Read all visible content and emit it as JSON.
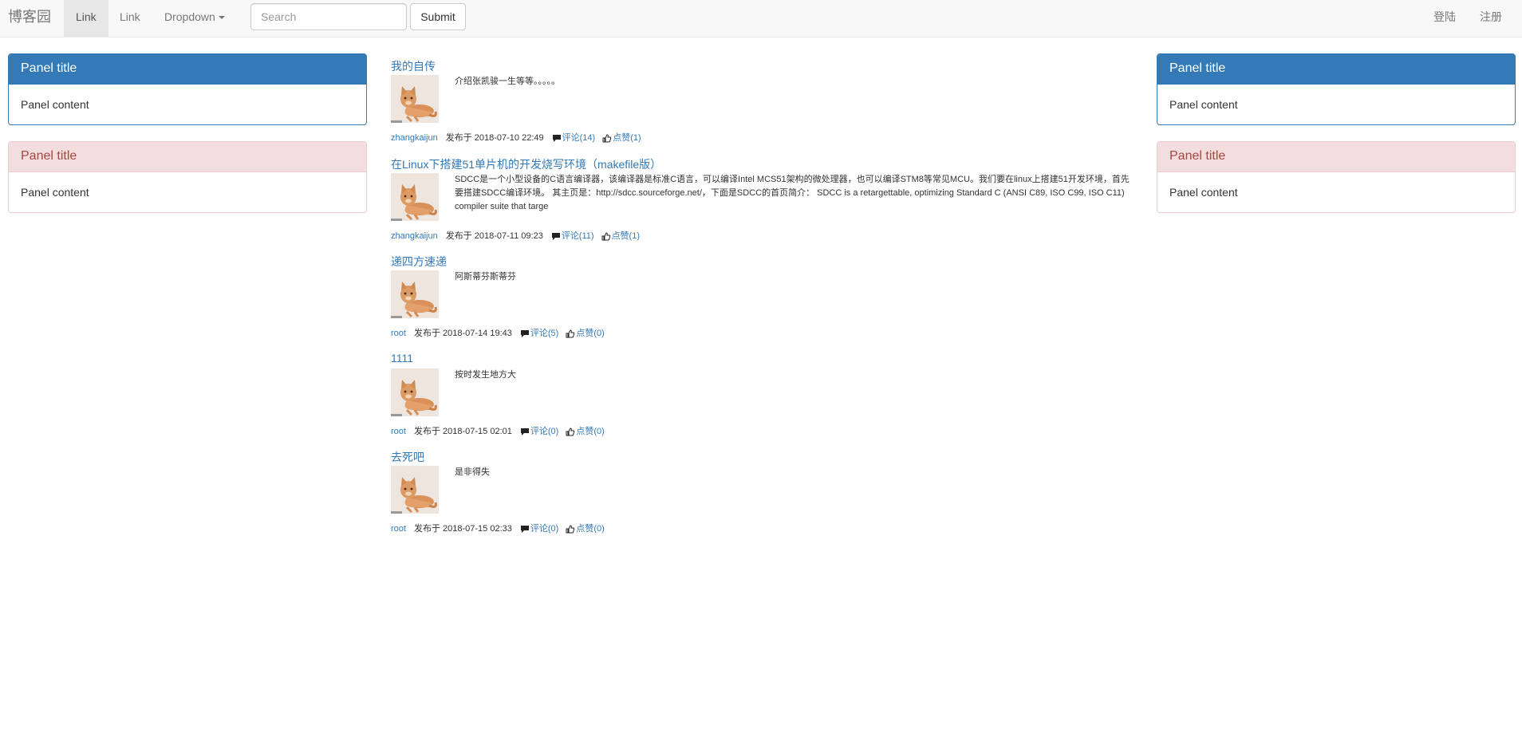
{
  "navbar": {
    "brand": "博客园",
    "links": [
      "Link",
      "Link"
    ],
    "dropdown_label": "Dropdown",
    "search_placeholder": "Search",
    "submit_label": "Submit",
    "login_label": "登陆",
    "register_label": "注册"
  },
  "left_panels": [
    {
      "title": "Panel title",
      "content": "Panel content",
      "style": "primary"
    },
    {
      "title": "Panel title",
      "content": "Panel content",
      "style": "danger"
    }
  ],
  "right_panels": [
    {
      "title": "Panel title",
      "content": "Panel content",
      "style": "primary"
    },
    {
      "title": "Panel title",
      "content": "Panel content",
      "style": "danger"
    }
  ],
  "articles": [
    {
      "title": "我的自传",
      "summary": "介绍张凯骏一生等等。。。。。",
      "author": "zhangkaijun",
      "date": "发布于 2018-07-10 22:49",
      "comments": "评论(14)",
      "likes": "点赞(1)"
    },
    {
      "title": "在Linux下搭建51单片机的开发烧写环境（makefile版）",
      "summary": "SDCC是一个小型设备的C语言编译器，该编译器是标准C语言，可以编译Intel MCS51架构的微处理器，也可以编译STM8等常见MCU。我们要在linux上搭建51开发环境，首先要搭建SDCC编译环境。 其主页是：http://sdcc.sourceforge.net/，下面是SDCC的首页简介： SDCC is a retargettable, optimizing Standard C (ANSI C89, ISO C99, ISO C11) compiler suite that targe",
      "author": "zhangkaijun",
      "date": "发布于 2018-07-11 09:23",
      "comments": "评论(11)",
      "likes": "点赞(1)"
    },
    {
      "title": "递四方速递",
      "summary": "阿斯蒂芬斯蒂芬",
      "author": "root",
      "date": "发布于 2018-07-14 19:43",
      "comments": "评论(5)",
      "likes": "点赞(0)"
    },
    {
      "title": "1111",
      "summary": "按时发生地方大",
      "author": "root",
      "date": "发布于 2018-07-15 02:01",
      "comments": "评论(0)",
      "likes": "点赞(0)"
    },
    {
      "title": "去死吧",
      "summary": "是非得失",
      "author": "root",
      "date": "发布于 2018-07-15 02:33",
      "comments": "评论(0)",
      "likes": "点赞(0)"
    }
  ],
  "icons": {
    "comment": "comment-icon",
    "like": "thumbs-up-icon",
    "thumbnail": "cat-photo-thumbnail"
  },
  "colors": {
    "link": "#337ab7",
    "primary": "#337ab7",
    "danger_bg": "#f2dede",
    "danger_text": "#a94442",
    "navbar_bg": "#f8f8f8"
  }
}
